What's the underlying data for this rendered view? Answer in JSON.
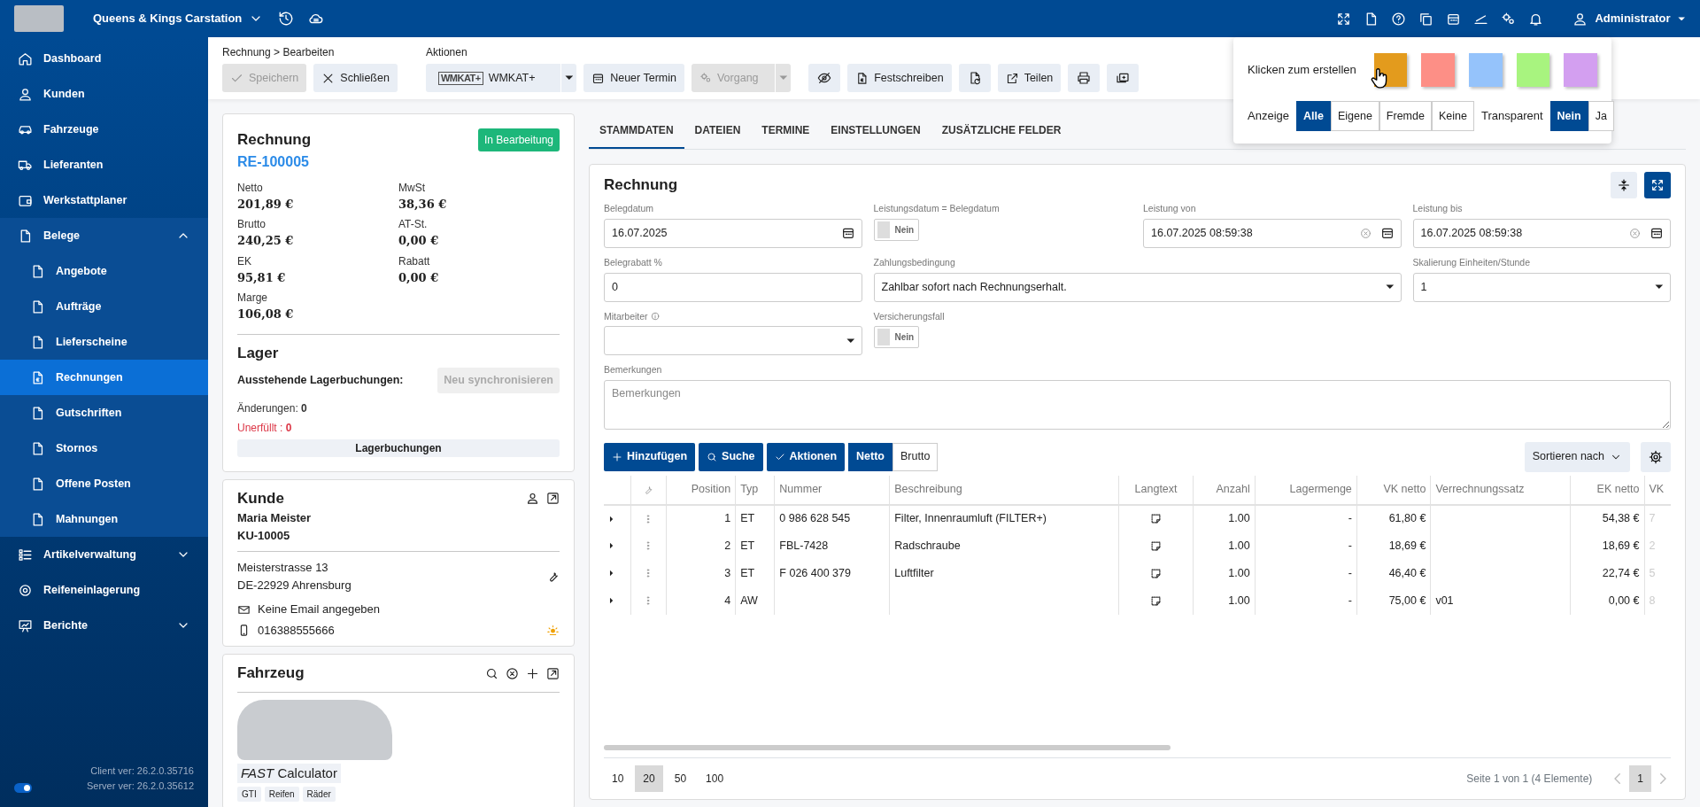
{
  "topbar": {
    "company": "Queens & Kings Carstation",
    "user": "Administrator"
  },
  "sidebar": {
    "items": [
      {
        "label": "Dashboard",
        "selected": false
      },
      {
        "label": "Kunden",
        "selected": false
      },
      {
        "label": "Fahrzeuge",
        "selected": false
      },
      {
        "label": "Lieferanten",
        "selected": false
      },
      {
        "label": "Werkstattplaner",
        "selected": false
      },
      {
        "label": "Belege",
        "selected": false,
        "expanded": true,
        "children": [
          {
            "label": "Angebote",
            "selected": false
          },
          {
            "label": "Aufträge",
            "selected": false
          },
          {
            "label": "Lieferscheine",
            "selected": false
          },
          {
            "label": "Rechnungen",
            "selected": true
          },
          {
            "label": "Gutschriften",
            "selected": false
          },
          {
            "label": "Stornos",
            "selected": false
          },
          {
            "label": "Offene Posten",
            "selected": false
          },
          {
            "label": "Mahnungen",
            "selected": false
          }
        ]
      },
      {
        "label": "Artikelverwaltung",
        "selected": false,
        "expanded": false
      },
      {
        "label": "Reifeneinlagerung",
        "selected": false
      },
      {
        "label": "Berichte",
        "selected": false,
        "expanded": false
      }
    ],
    "dark_mode_on": true,
    "versions": [
      "Client ver: 26.2.0.35716",
      "Server ver: 26.2.0.35612"
    ]
  },
  "toolbar": {
    "breadcrumb": "Rechnung > Bearbeiten",
    "actions_label": "Aktionen",
    "left_buttons": [
      {
        "label": "Speichern",
        "disabled": true
      },
      {
        "label": "Schließen",
        "disabled": false
      }
    ],
    "actions": [
      {
        "kind": "split",
        "logo": "WMKAT+",
        "label": "WMKAT+",
        "disabled": false
      },
      {
        "kind": "button",
        "label": "Neuer Termin",
        "disabled": false
      },
      {
        "kind": "split",
        "label": "Vorgang",
        "disabled": true
      },
      {
        "kind": "icon",
        "disabled": false
      },
      {
        "kind": "button",
        "label": "Festschreiben",
        "disabled": false
      },
      {
        "kind": "icon",
        "disabled": false
      },
      {
        "kind": "button",
        "label": "Teilen",
        "disabled": false
      },
      {
        "kind": "icon",
        "disabled": false
      },
      {
        "kind": "icon",
        "disabled": false
      }
    ]
  },
  "invoice": {
    "title": "Rechnung",
    "number": "RE-100005",
    "status": "In Bearbeitung",
    "amounts": [
      {
        "label": "Netto",
        "value": "201,89 €"
      },
      {
        "label": "MwSt",
        "value": "38,36 €"
      },
      {
        "label": "Brutto",
        "value": "240,25 €"
      },
      {
        "label": "AT-St.",
        "value": "0,00 €"
      },
      {
        "label": "EK",
        "value": "95,81 €"
      },
      {
        "label": "Rabatt",
        "value": "0,00 €"
      },
      {
        "label": "Marge",
        "value": "106,08 €"
      }
    ],
    "lager": {
      "title": "Lager",
      "pending_label": "Ausstehende Lagerbuchungen:",
      "sync_button": {
        "label": "Neu synchronisieren",
        "disabled": true
      },
      "changes": {
        "label": "Änderungen:",
        "value": "0"
      },
      "unfulfilled": {
        "label": "Unerfüllt :",
        "value": "0"
      },
      "bookings_button": "Lagerbuchungen"
    }
  },
  "customer": {
    "title": "Kunde",
    "name": "Maria Meister",
    "number": "KU-10005",
    "address": [
      "Meisterstrasse 13",
      "DE-22929 Ahrensburg"
    ],
    "email": "Keine Email angegeben",
    "phone": "016388555666"
  },
  "vehicle": {
    "title": "Fahrzeug",
    "calculator": "*FAST* Calculator",
    "chips": [
      "GTI",
      "Reifen",
      "Räder"
    ]
  },
  "tabs": [
    {
      "label": "STAMMDATEN",
      "selected": true
    },
    {
      "label": "DATEIEN",
      "selected": false
    },
    {
      "label": "TERMINE",
      "selected": false
    },
    {
      "label": "EINSTELLUNGEN",
      "selected": false
    },
    {
      "label": "ZUSÄTZLICHE FELDER",
      "selected": false
    }
  ],
  "form": {
    "title": "Rechnung",
    "fields": [
      {
        "kind": "date",
        "label": "Belegdatum",
        "value": "16.07.2025"
      },
      {
        "kind": "switch",
        "label": "Leistungsdatum = Belegdatum",
        "on": false,
        "text": "Nein"
      },
      {
        "kind": "datetime",
        "label": "Leistung von",
        "value": "16.07.2025 08:59:38"
      },
      {
        "kind": "datetime",
        "label": "Leistung bis",
        "value": "16.07.2025 08:59:38"
      },
      {
        "kind": "text",
        "label": "Belegrabatt %",
        "value": "0"
      },
      {
        "kind": "select",
        "label": "Zahlungsbedingung",
        "value": "Zahlbar sofort nach Rechnungserhalt.",
        "wide": true
      },
      {
        "kind": "select",
        "label": "Skalierung Einheiten/Stunde",
        "value": "1"
      },
      {
        "kind": "select",
        "label": "Mitarbeiter",
        "info": true
      },
      {
        "kind": "switch",
        "label": "Versicherungsfall",
        "on": false,
        "text": "Nein"
      },
      {
        "kind": "textarea",
        "label": "Bemerkungen",
        "placeholder": "Bemerkungen"
      }
    ]
  },
  "grid": {
    "buttons": [
      {
        "label": "Hinzufügen"
      },
      {
        "label": "Suche"
      },
      {
        "label": "Aktionen"
      }
    ],
    "price_mode": [
      {
        "label": "Netto",
        "selected": true
      },
      {
        "label": "Brutto",
        "selected": false
      }
    ],
    "sort_label": "Sortieren nach",
    "columns": [
      {
        "label": "Position",
        "kind": "number"
      },
      {
        "label": "Typ",
        "kind": "text"
      },
      {
        "label": "Nummer",
        "kind": "text"
      },
      {
        "label": "Beschreibung",
        "kind": "text"
      },
      {
        "label": "Langtext",
        "kind": "icon"
      },
      {
        "label": "Anzahl",
        "kind": "number"
      },
      {
        "label": "Lagermenge",
        "kind": "number"
      },
      {
        "label": "VK netto",
        "kind": "number"
      },
      {
        "label": "Verrechnungssatz",
        "kind": "text"
      },
      {
        "label": "EK netto",
        "kind": "number"
      },
      {
        "label": "VK",
        "kind": "cut"
      }
    ],
    "rows": [
      {
        "cells": [
          "1",
          "ET",
          "0 986 628 545",
          "Filter, Innenraumluft (FILTER+)",
          null,
          "1.00",
          "-",
          "61,80 €",
          null,
          "54,38 €",
          "7"
        ]
      },
      {
        "cells": [
          "2",
          "ET",
          "FBL-7428",
          "Radschraube",
          null,
          "1.00",
          "-",
          "18,69 €",
          null,
          "18,69 €",
          "2"
        ]
      },
      {
        "cells": [
          "3",
          "ET",
          "F 026 400 379",
          "Luftfilter",
          null,
          "1.00",
          "-",
          "46,40 €",
          null,
          "22,74 €",
          "5"
        ]
      },
      {
        "cells": [
          "4",
          "AW",
          null,
          null,
          null,
          "1.00",
          "-",
          "75,00 €",
          "v01",
          "0,00 €",
          "8"
        ]
      }
    ],
    "page_sizes": [
      {
        "label": "10",
        "selected": false
      },
      {
        "label": "20",
        "selected": true
      },
      {
        "label": "50",
        "selected": false
      },
      {
        "label": "100",
        "selected": false
      }
    ],
    "page_info": "Seite 1 von 1 (4 Elemente)",
    "pages": [
      {
        "label": "1",
        "selected": true
      }
    ]
  },
  "notes_popup": {
    "create_label": "Klicken zum erstellen",
    "colors": [
      {
        "color": "#e39b1d"
      },
      {
        "color": "#fd8f86"
      },
      {
        "color": "#95c3fb"
      },
      {
        "color": "#a8f47f"
      },
      {
        "color": "#d39ff0"
      }
    ],
    "display_label": "Anzeige",
    "display_options": [
      {
        "label": "Alle",
        "selected": true
      },
      {
        "label": "Eigene",
        "selected": false
      },
      {
        "label": "Fremde",
        "selected": false
      },
      {
        "label": "Keine",
        "selected": false
      }
    ],
    "transparent_label": "Transparent",
    "transparent_options": [
      {
        "label": "Nein",
        "selected": true
      },
      {
        "label": "Ja",
        "selected": false
      }
    ]
  }
}
